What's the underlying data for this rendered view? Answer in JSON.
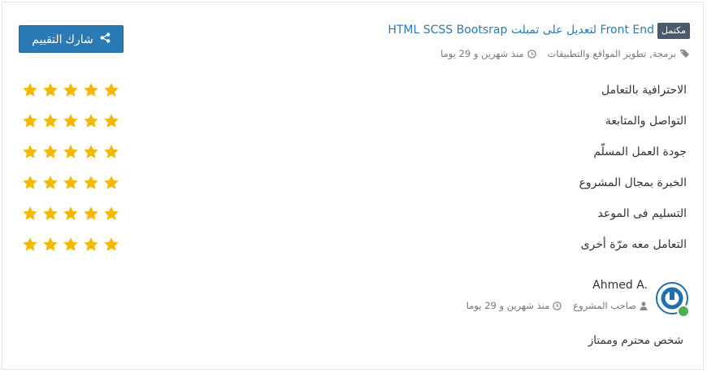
{
  "project": {
    "status_badge": "مكتمل",
    "title": "Front End لتعديل على تمبلت HTML SCSS Bootsrap",
    "category": "برمجة, تطوير المواقع والتطبيقات",
    "time": "منذ شهرين و 29 يوما"
  },
  "share_button": {
    "label": "شارك التقييم",
    "icon": "share-icon"
  },
  "ratings": [
    {
      "label": "الاحترافية بالتعامل",
      "stars": 5,
      "max": 5
    },
    {
      "label": "التواصل والمتابعة",
      "stars": 5,
      "max": 5
    },
    {
      "label": "جودة العمل المسلّم",
      "stars": 5,
      "max": 5
    },
    {
      "label": "الخبرة بمجال المشروع",
      "stars": 5,
      "max": 5
    },
    {
      "label": "التسليم فى الموعد",
      "stars": 5,
      "max": 5
    },
    {
      "label": "التعامل معه مرّة أخرى",
      "stars": 5,
      "max": 5
    }
  ],
  "reviewer": {
    "name": "Ahmed A.",
    "role": "صاحب المشروع",
    "time": "منذ شهرين و 29 يوما",
    "online": true
  },
  "comment": "شخص محترم وممتاز",
  "colors": {
    "accent": "#2a7ab5",
    "badge": "#4a5a6b",
    "star": "#f5b800",
    "online": "#4caf50"
  }
}
